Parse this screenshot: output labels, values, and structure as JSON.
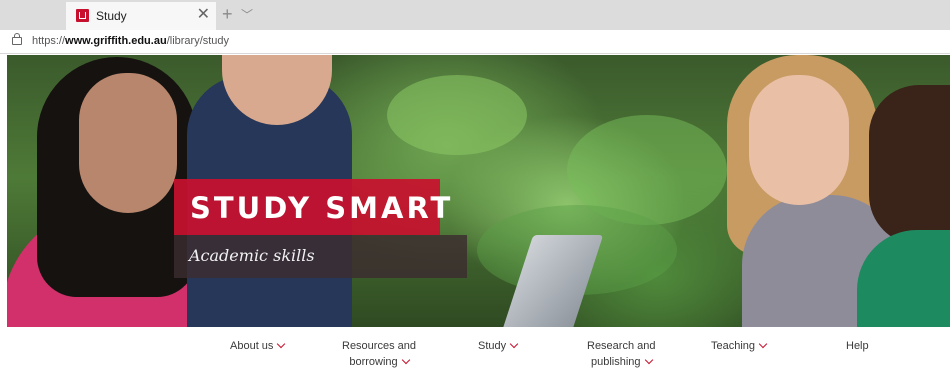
{
  "browser": {
    "tab": {
      "title": "Study"
    },
    "address": {
      "prefix": "https://",
      "domain": "www.griffith.edu.au",
      "path": "/library/study"
    }
  },
  "hero": {
    "title": "STUDY SMART",
    "subtitle": "Academic skills"
  },
  "nav": {
    "items": [
      {
        "label": "About us",
        "has_dropdown": true
      },
      {
        "label_line1": "Resources and",
        "label_line2": "borrowing",
        "has_dropdown": true
      },
      {
        "label": "Study",
        "has_dropdown": true
      },
      {
        "label_line1": "Research and",
        "label_line2": "publishing",
        "has_dropdown": true
      },
      {
        "label": "Teaching",
        "has_dropdown": true
      },
      {
        "label": "Help",
        "has_dropdown": false
      }
    ]
  },
  "colors": {
    "accent": "#c8102e",
    "subtitle_bg": "#3c2c30"
  }
}
